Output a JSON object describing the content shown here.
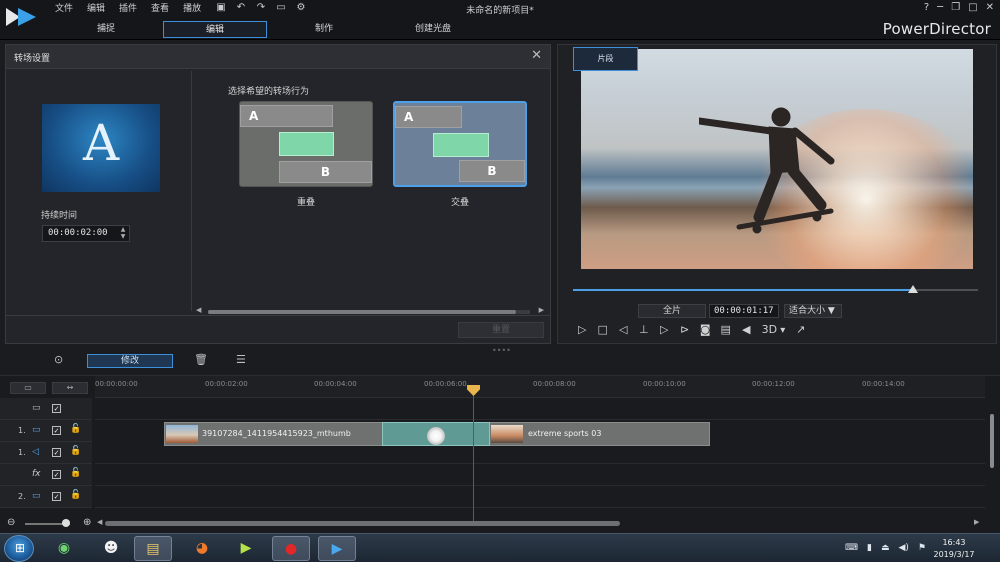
{
  "app": {
    "title": "未命名的新项目*",
    "brand": "PowerDirector",
    "menu": [
      "文件",
      "编辑",
      "插件",
      "查看",
      "播放"
    ],
    "window_controls": [
      "?",
      "─",
      "❐",
      "□",
      "✕"
    ],
    "mode_tabs": [
      {
        "label": "捕捉",
        "active": false
      },
      {
        "label": "编辑",
        "active": true
      },
      {
        "label": "制作",
        "active": false
      },
      {
        "label": "创建光盘",
        "active": false
      }
    ]
  },
  "dialog": {
    "title": "转场设置",
    "duration_label": "持续时间",
    "duration_value": "00:00:02:00",
    "choose_label": "选择希望的转场行为",
    "options": [
      {
        "label": "重叠",
        "a": "A",
        "b": "B",
        "selected": false
      },
      {
        "label": "交叠",
        "a": "A",
        "b": "B",
        "selected": true
      }
    ],
    "reset_label": "重置",
    "preview_letter": "A"
  },
  "preview": {
    "clip_tab": "片段",
    "movie_tab": "全片",
    "timecode": "00:00:01:17",
    "fit_label": "适合大小",
    "progress": 0.84,
    "three_d": "3D"
  },
  "timeline": {
    "modify_label": "修改",
    "ruler": [
      "00:00:00:00",
      "00:00:02:00",
      "00:00:04:00",
      "00:00:06:00",
      "00:00:08:00",
      "00:00:10:00",
      "00:00:12:00",
      "00:00:14:00"
    ],
    "tracks": [
      {
        "num": "",
        "icon": "▭"
      },
      {
        "num": "1.",
        "icon": "▭"
      },
      {
        "num": "1.",
        "icon": "◁"
      },
      {
        "num": "",
        "icon": "fx"
      },
      {
        "num": "2.",
        "icon": "▭"
      }
    ],
    "clip1_name": "39107284_1411954415923_mthumb",
    "clip2_name": "extreme sports 03"
  },
  "taskbar": {
    "time": "16:43",
    "date": "2019/3/17"
  },
  "colors": {
    "accent": "#3c8fd8",
    "playhead": "#d6262b",
    "transition": "#7fd6a8"
  }
}
